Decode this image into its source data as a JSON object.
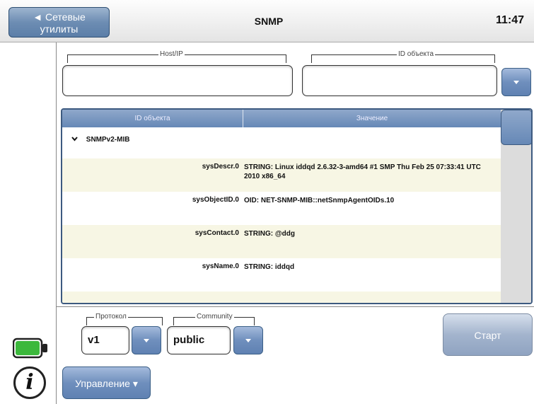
{
  "header": {
    "back_label_line1": "◄ Сетевые",
    "back_label_line2": "утилиты",
    "title": "SNMP",
    "time": "11:47"
  },
  "form": {
    "host_label": "Host/IP",
    "host_value": "",
    "oid_label": "ID объекта",
    "oid_value": ""
  },
  "table": {
    "columns": [
      "ID объекта",
      "Значение"
    ],
    "group": "SNMPv2-MIB",
    "rows": [
      {
        "oid": "sysDescr.0",
        "value": "STRING: Linux iddqd 2.6.32-3-amd64 #1 SMP Thu Feb 25 07:33:41 UTC 2010 x86_64"
      },
      {
        "oid": "sysObjectID.0",
        "value": "OID: NET-SNMP-MIB::netSnmpAgentOIDs.10"
      },
      {
        "oid": "sysContact.0",
        "value": "STRING: @ddg"
      },
      {
        "oid": "sysName.0",
        "value": "STRING: iddqd"
      }
    ]
  },
  "controls": {
    "protocol_label": "Протокол",
    "protocol_value": "v1",
    "community_label": "Community",
    "community_value": "public",
    "start_label": "Старт",
    "manage_label": "Управление ▾"
  },
  "icons": {
    "battery": "battery-icon",
    "info": "info-icon",
    "dropdown": "chevron-down-icon",
    "collapse": "collapse-arrow-icon"
  },
  "colors": {
    "accent": "#6d8db3",
    "battery": "#3cb83c"
  }
}
